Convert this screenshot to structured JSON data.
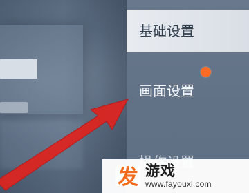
{
  "menu": {
    "items": [
      {
        "label": "基础设置"
      },
      {
        "label": "画面设置"
      },
      {
        "label": "操作设置"
      }
    ]
  },
  "watermark": {
    "logo_text": "发",
    "brand_text": "游戏",
    "url": "www.fayouxi.com"
  },
  "colors": {
    "arrow": "#d92622",
    "notification_dot": "#ff6b22",
    "logo_orange": "#f36b1d"
  },
  "icons": {
    "notification": "notification-dot-icon",
    "arrow": "red-arrow-icon",
    "logo": "fayouxi-logo-icon"
  }
}
